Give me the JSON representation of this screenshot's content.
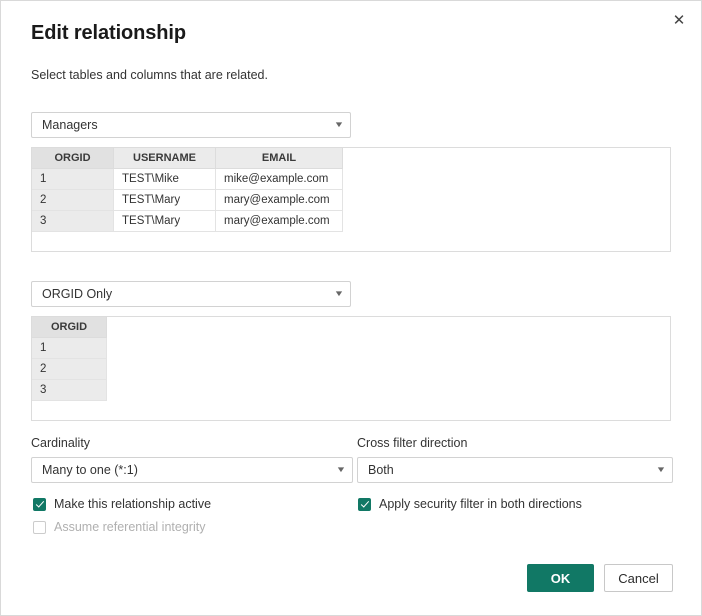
{
  "dialog": {
    "title": "Edit relationship",
    "subtitle": "Select tables and columns that are related.",
    "close_icon": "close-icon",
    "accent_color": "#117865",
    "border_color": "#d9d9d9"
  },
  "table1": {
    "dropdown_value": "Managers",
    "chevron_icon": "chevron-down-icon",
    "columns": [
      "ORGID",
      "USERNAME",
      "EMAIL"
    ],
    "selected_column": "ORGID",
    "rows": [
      [
        "1",
        "TEST\\Mike",
        "mike@example.com"
      ],
      [
        "2",
        "TEST\\Mary",
        "mary@example.com"
      ],
      [
        "3",
        "TEST\\Mary",
        "mary@example.com"
      ]
    ]
  },
  "table2": {
    "dropdown_value": "ORGID Only",
    "chevron_icon": "chevron-down-icon",
    "columns": [
      "ORGID"
    ],
    "selected_column": "ORGID",
    "rows": [
      [
        "1"
      ],
      [
        "2"
      ],
      [
        "3"
      ]
    ]
  },
  "cardinality": {
    "label": "Cardinality",
    "value": "Many to one (*:1)",
    "chevron_icon": "chevron-down-icon"
  },
  "cross_filter": {
    "label": "Cross filter direction",
    "value": "Both",
    "chevron_icon": "chevron-down-icon"
  },
  "checkboxes": {
    "make_active": {
      "label": "Make this relationship active",
      "checked": true,
      "enabled": true
    },
    "referential_integrity": {
      "label": "Assume referential integrity",
      "checked": false,
      "enabled": false
    },
    "security_filter": {
      "label": "Apply security filter in both directions",
      "checked": true,
      "enabled": true
    }
  },
  "footer": {
    "ok_label": "OK",
    "cancel_label": "Cancel"
  }
}
